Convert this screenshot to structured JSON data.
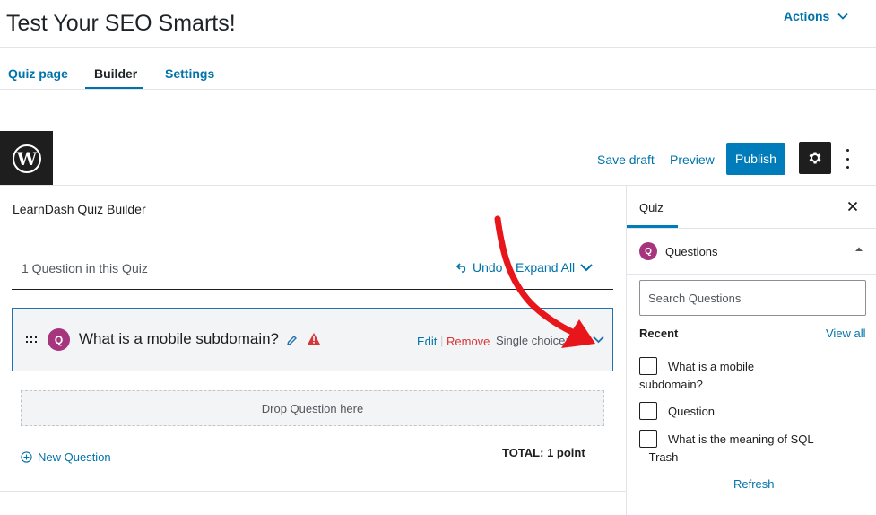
{
  "page": {
    "title": "Test Your SEO Smarts!",
    "actions_label": "Actions"
  },
  "tabs": [
    {
      "label": "Quiz page",
      "active": false
    },
    {
      "label": "Builder",
      "active": true
    },
    {
      "label": "Settings",
      "active": false
    }
  ],
  "toolbar": {
    "save_draft": "Save draft",
    "preview": "Preview",
    "publish": "Publish"
  },
  "builder": {
    "title": "LearnDash Quiz Builder",
    "question_count": "1 Question in this Quiz",
    "undo": "Undo",
    "expand_all": "Expand All",
    "question": {
      "badge": "Q",
      "title": "What is a mobile subdomain?",
      "edit": "Edit",
      "remove": "Remove",
      "type": "Single choice: 1"
    },
    "drop_zone": "Drop Question here",
    "new_question": "New Question",
    "total": "TOTAL: 1 point"
  },
  "sidebar": {
    "tab": "Quiz",
    "panel": {
      "badge": "Q",
      "title": "Questions",
      "search_placeholder": "Search Questions",
      "recent_label": "Recent",
      "view_all": "View all",
      "items": [
        {
          "line1": "What is a mobile",
          "line2": "subdomain?",
          "checked": false
        },
        {
          "line1": "Question",
          "line2": "",
          "checked": false
        },
        {
          "line1": "What is the meaning of SQL",
          "line2": "– Trash",
          "checked": false
        }
      ],
      "refresh": "Refresh"
    }
  },
  "colors": {
    "link": "#0073aa",
    "publish": "#007cba",
    "badge": "#a6357e",
    "danger": "#d63638",
    "annotation_arrow": "#e8161b"
  },
  "icons": [
    "wordpress-logo-icon",
    "chevron-down-icon",
    "gear-icon",
    "kebab-menu-icon",
    "undo-icon",
    "drag-handle-icon",
    "pencil-icon",
    "warning-icon",
    "plus-circle-icon",
    "close-icon",
    "caret-up-icon",
    "annotation-arrow-icon"
  ]
}
